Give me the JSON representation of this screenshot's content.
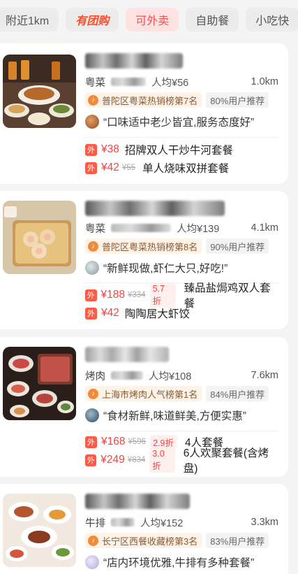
{
  "filters": [
    {
      "label": "附近1km",
      "style": "plain"
    },
    {
      "label": "有团购",
      "style": "brand"
    },
    {
      "label": "可外卖",
      "style": "active"
    },
    {
      "label": "自助餐",
      "style": "plain"
    },
    {
      "label": "小吃快",
      "style": "plain"
    }
  ],
  "listings": [
    {
      "cuisine": "粤菜",
      "avg_price": "人均¥56",
      "distance": "1.0km",
      "rank": "普陀区粤菜热销榜第7名",
      "recommend": "80%用户推荐",
      "review": "“口味适中老少皆宜,服务态度好”",
      "deals": [
        {
          "price": "¥38",
          "original": "",
          "discount": "",
          "title": "招牌双人干炒牛河套餐"
        },
        {
          "price": "¥42",
          "original": "¥55",
          "discount": "",
          "title": "单人烧味双拼套餐"
        }
      ]
    },
    {
      "cuisine": "粤菜",
      "avg_price": "人均¥139",
      "distance": "4.1km",
      "rank": "普陀区粤菜热销榜第8名",
      "recommend": "90%用户推荐",
      "review": "“新鲜现做,虾仁大只,好吃!”",
      "deals": [
        {
          "price": "¥188",
          "original": "¥334",
          "discount": "5.7折",
          "title": "臻品盐焗鸡双人套餐"
        },
        {
          "price": "¥42",
          "original": "",
          "discount": "",
          "title": "陶陶居大虾饺"
        }
      ]
    },
    {
      "cuisine": "烤肉",
      "avg_price": "人均¥108",
      "distance": "7.6km",
      "rank": "上海市烤肉人气榜第1名",
      "recommend": "84%用户推荐",
      "review": "“食材新鲜,味道鲜美,方便实惠”",
      "deals": [
        {
          "price": "¥168",
          "original": "¥596",
          "discount": "2.9折",
          "title": "4人套餐"
        },
        {
          "price": "¥249",
          "original": "¥834",
          "discount": "3.0折",
          "title": "6人欢聚套餐(含烤盘)"
        }
      ]
    },
    {
      "cuisine": "牛排",
      "avg_price": "人均¥152",
      "distance": "3.3km",
      "rank": "长宁区西餐收藏榜第3名",
      "recommend": "83%用户推荐",
      "review": "“店内环境优雅,牛排有多种套餐”",
      "deals": []
    }
  ],
  "icons": {
    "takeaway_badge": "外",
    "rank_badge": "♪"
  },
  "colors": {
    "accent_red": "#ff4040",
    "active_chip_bg": "#ffe3e3",
    "rank_bg": "#fff3e8"
  }
}
